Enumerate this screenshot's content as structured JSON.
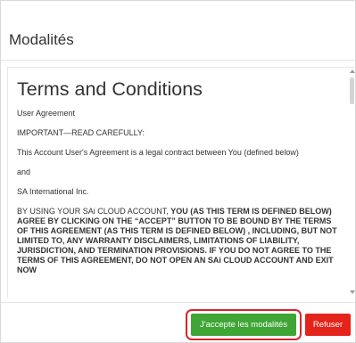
{
  "dialog": {
    "title": "Modalités"
  },
  "terms": {
    "heading": "Terms and Conditions",
    "line1": "User Agreement",
    "line2": "IMPORTANT—READ CAREFULLY:",
    "line3": "This Account User's Agreement is a legal contract between You (defined below)",
    "line4": "and",
    "line5": "SA International Inc.",
    "para_lead": "BY USING YOUR SAi CLOUD ACCOUNT,  ",
    "para_bold": "YOU (AS THIS TERM IS DEFINED BELOW) AGREE BY CLICKING ON THE “ACCEPT” BUTTON TO BE BOUND BY THE TERMS OF THIS AGREEMENT (AS THIS TERM IS DEFINED BELOW) , INCLUDING, BUT NOT LIMITED TO, ANY WARRANTY DISCLAIMERS, LIMITATIONS OF LIABILITY, JURISDICTION, AND TERMINATION PROVISIONS. IF YOU DO NOT AGREE TO THE TERMS OF THIS AGREEMENT, DO NOT OPEN AN SAi CLOUD ACCOUNT AND EXIT NOW"
  },
  "footer": {
    "accept_label": "J'accepte les modalités",
    "refuse_label": "Refuser"
  },
  "colors": {
    "accept": "#3fa535",
    "refuse": "#e4231a",
    "highlight": "#d9242a"
  },
  "icons": {
    "scroll_up": "scroll-up-arrow-icon",
    "scroll_down": "scroll-down-arrow-icon"
  }
}
